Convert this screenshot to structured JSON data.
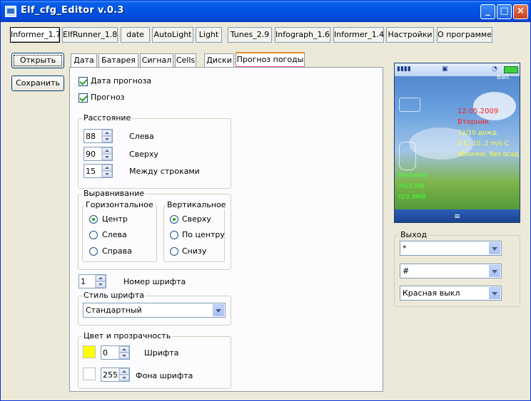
{
  "window": {
    "title": "Elf_cfg_Editor v.0.3"
  },
  "toolbar_tabs": [
    "Informer_1.7",
    "ElfRunner_1.8",
    "date",
    "AutoLight",
    "Light",
    "Tunes_2.9",
    "Infograph_1.6",
    "Informer_1.4",
    "Настройки",
    "О программе"
  ],
  "side_buttons": {
    "open": "Открыть",
    "save": "Сохранить"
  },
  "tabs": [
    "Дата",
    "Батарея",
    "Сигнал",
    "Cells",
    "Диски",
    "Прогноз погоды"
  ],
  "panel": {
    "check_date_forecast": "Дата прогноза",
    "check_forecast": "Прогноз",
    "distance": {
      "title": "Расстояние",
      "left_value": "88",
      "left_label": "Слева",
      "top_value": "90",
      "top_label": "Сверху",
      "line_value": "15",
      "line_label": "Между строками"
    },
    "align": {
      "title": "Выравнивание",
      "horizontal": {
        "title": "Горизонтальное",
        "options": [
          "Центр",
          "Слева",
          "Справа"
        ]
      },
      "vertical": {
        "title": "Вертикальное",
        "options": [
          "Сверху",
          "По центру",
          "Снизу"
        ]
      }
    },
    "font_number": {
      "value": "1",
      "label": "Номер шрифта"
    },
    "font_style": {
      "title": "Стиль шрифта",
      "value": "Стандартный"
    },
    "color": {
      "title": "Цвет и прозрачность",
      "font_swatch": "#ffff00",
      "font_alpha": "0",
      "font_label": "Шрифта",
      "bg_swatch": "#ffffff",
      "bg_alpha": "255",
      "bg_label": "Фона шрифта"
    }
  },
  "preview": {
    "ball_label": "Ball.",
    "date": "12.05.2009",
    "weekday": "Вторник",
    "line1": "12/10 дожд",
    "line2": "8 C, 10..2 m/s C",
    "line3": "облачно, без осад",
    "mem1": "Msmemb",
    "mem2": "Yb/2.MB",
    "mem3": "G/3.9MB"
  },
  "exit_group": {
    "title": "Выход",
    "combo1": "*",
    "combo2": "#",
    "combo3": "Красная выкл"
  }
}
